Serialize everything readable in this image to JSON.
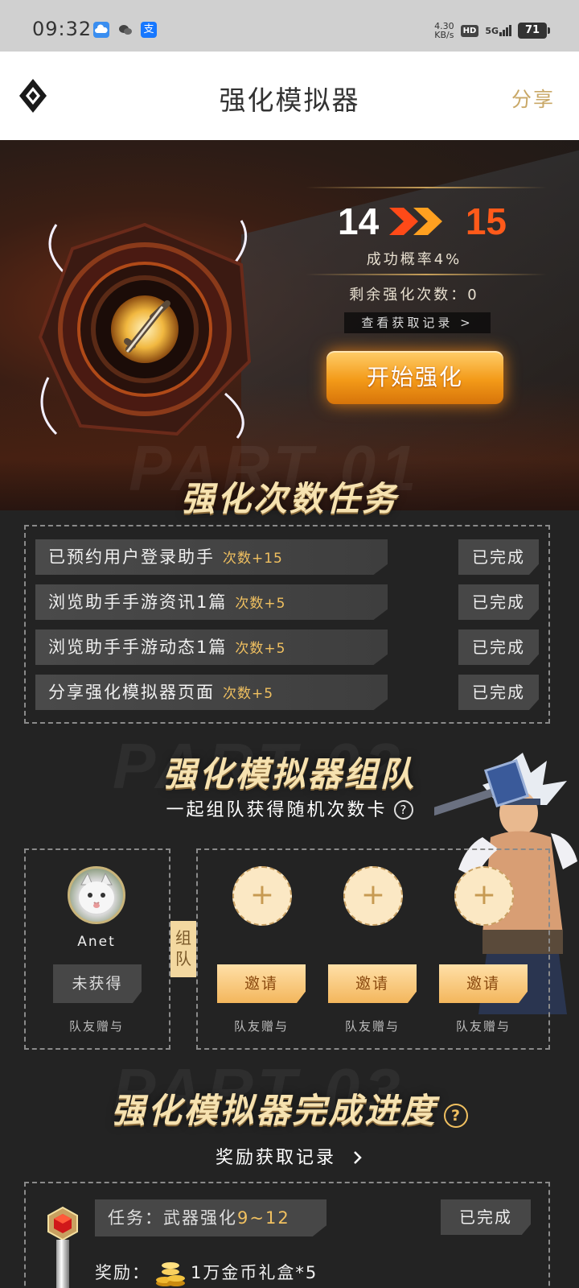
{
  "status_bar": {
    "time": "09:32",
    "speed_value": "4.30",
    "speed_unit": "KB/s",
    "hd": "HD",
    "network": "5G",
    "battery": "71",
    "app_icons": [
      "cloud-icon",
      "wechat-icon",
      "alipay-icon"
    ],
    "alipay_glyph": "支"
  },
  "header": {
    "title": "强化模拟器",
    "share": "分享"
  },
  "hero": {
    "level_from": "14",
    "level_to": "15",
    "success_rate": "成功概率4%",
    "remaining": "剩余强化次数：0",
    "record_link": "查看获取记录 >",
    "start_button": "开始强化"
  },
  "section1": {
    "bg_text": "PART 01",
    "title": "强化次数任务",
    "tasks": [
      {
        "label": "已预约用户登录助手",
        "bonus": "次数+15",
        "status": "已完成"
      },
      {
        "label": "浏览助手手游资讯1篇",
        "bonus": "次数+5",
        "status": "已完成"
      },
      {
        "label": "浏览助手手游动态1篇",
        "bonus": "次数+5",
        "status": "已完成"
      },
      {
        "label": "分享强化模拟器页面",
        "bonus": "次数+5",
        "status": "已完成"
      }
    ]
  },
  "section2": {
    "bg_text": "PART 02",
    "title": "强化模拟器组队",
    "hint": "一起组队获得随机次数卡",
    "team_tag": "组队",
    "me": {
      "name": "Anet",
      "status": "未获得",
      "gift_label": "队友赠与"
    },
    "slots": [
      {
        "plus": "+",
        "invite": "邀请",
        "gift_label": "队友赠与"
      },
      {
        "plus": "+",
        "invite": "邀请",
        "gift_label": "队友赠与"
      },
      {
        "plus": "+",
        "invite": "邀请",
        "gift_label": "队友赠与"
      }
    ]
  },
  "section3": {
    "bg_text": "PART 03",
    "title": "强化模拟器完成进度",
    "reward_link": "奖励获取记录",
    "item": {
      "task_prefix": "任务：武器强化",
      "task_range": "9~12",
      "status": "已完成",
      "reward_prefix": "奖励：",
      "reward_text": "1万金币礼盒*5"
    }
  },
  "colors": {
    "accent_gold": "#c9a867",
    "bonus_yellow": "#f0c060",
    "level_orange": "#ff5a1a",
    "panel_gray": "#474747"
  }
}
